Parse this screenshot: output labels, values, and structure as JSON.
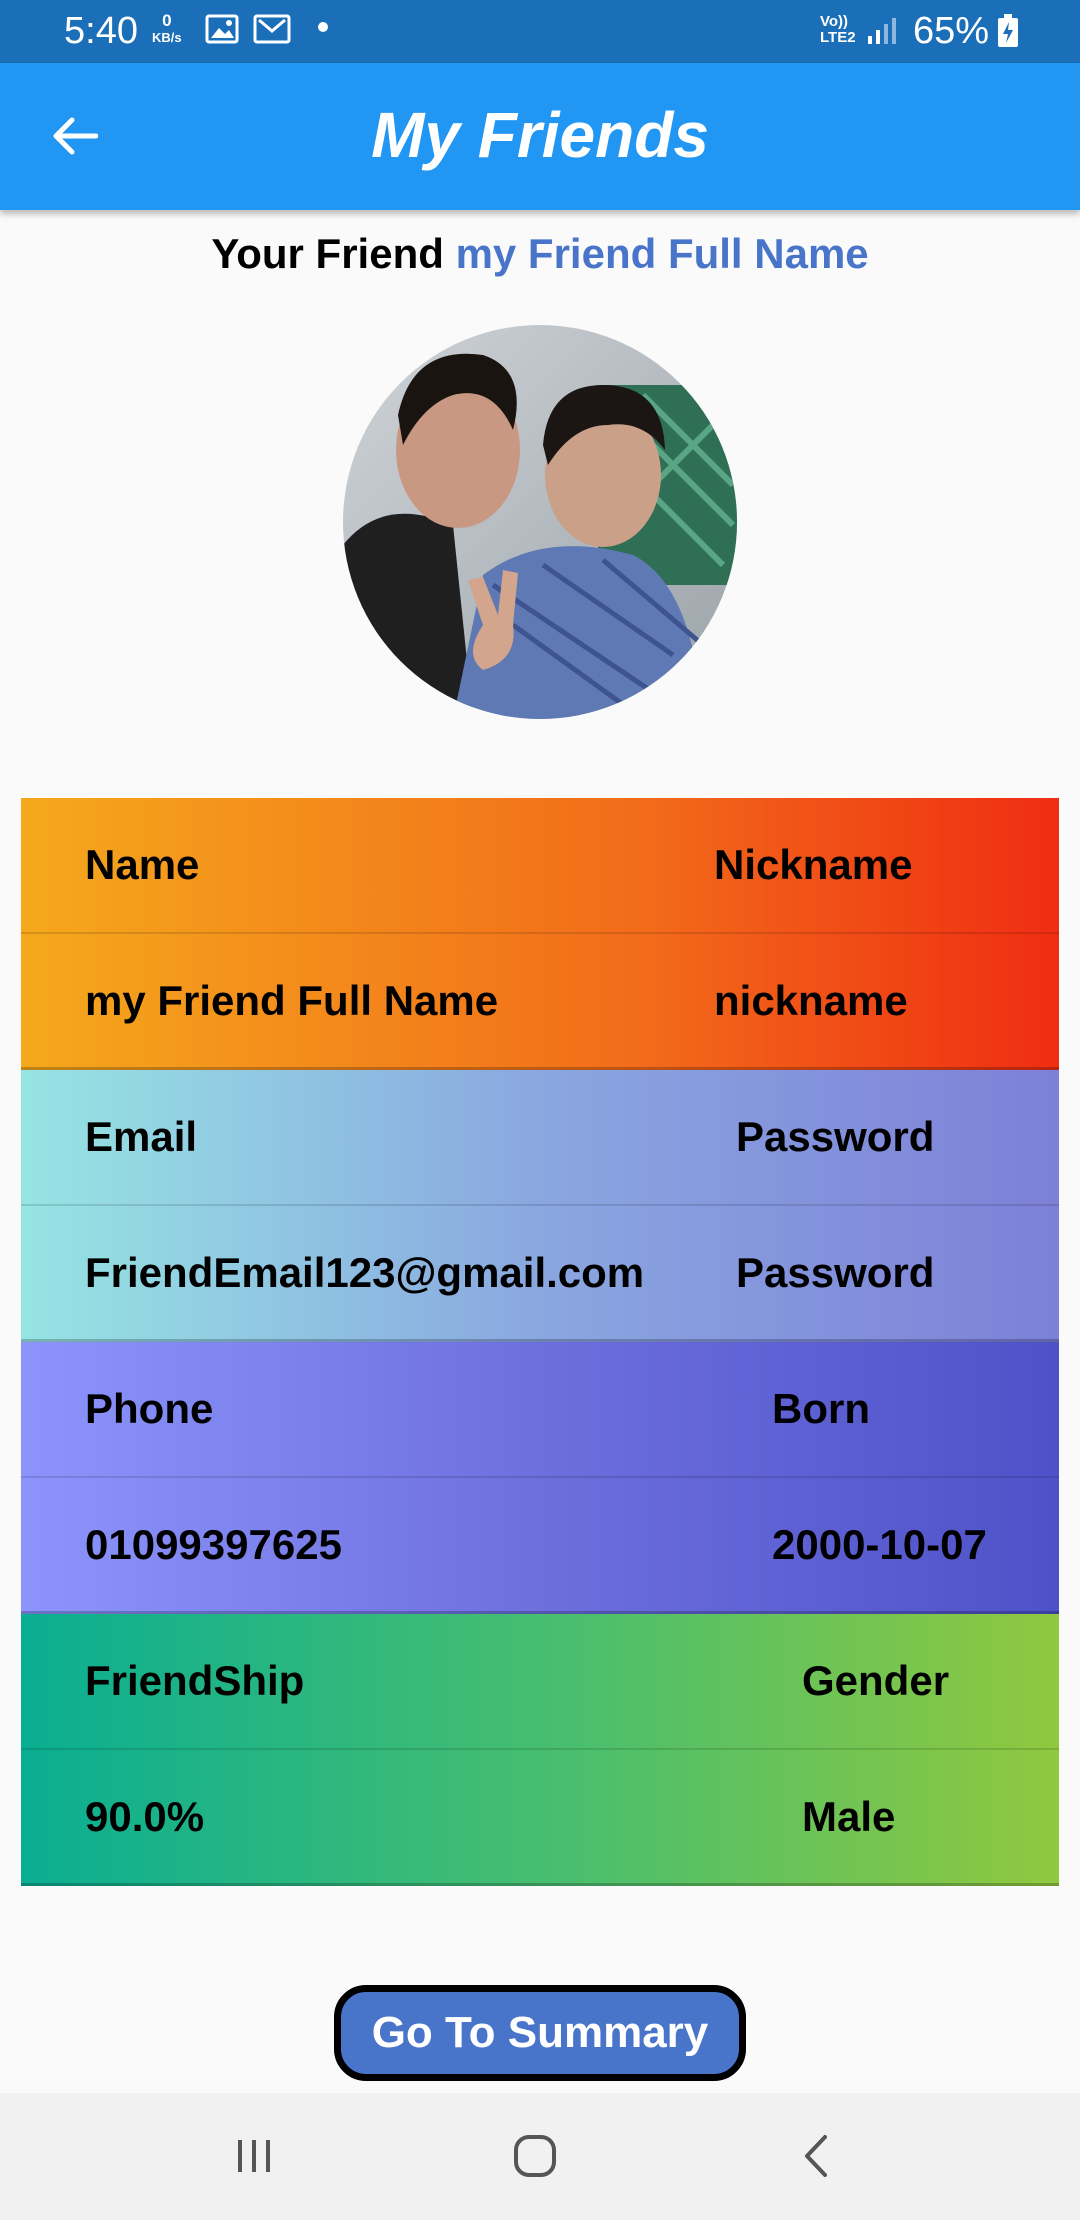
{
  "status_bar": {
    "time": "5:40",
    "net_speed_value": "0",
    "net_speed_unit": "KB/s",
    "signal_label_top": "Vo))",
    "signal_label_bottom": "LTE2",
    "battery": "65%"
  },
  "app_bar": {
    "title": "My Friends"
  },
  "heading": {
    "prefix": "Your Friend",
    "name": "my Friend Full Name"
  },
  "table": {
    "groups": [
      {
        "label_left": "Name",
        "label_right": "Nickname",
        "value_left": "my Friend Full Name",
        "value_right": "nickname"
      },
      {
        "label_left": "Email",
        "label_right": "Password",
        "value_left": "FriendEmail123@gmail.com",
        "value_right": "Password"
      },
      {
        "label_left": "Phone",
        "label_right": "Born",
        "value_left": "01099397625",
        "value_right": "2000-10-07"
      },
      {
        "label_left": "FriendShip",
        "label_right": "Gender",
        "value_left": "90.0%",
        "value_right": "Male"
      }
    ]
  },
  "summary_button": {
    "label": "Go To Summary"
  },
  "colors": {
    "status_bar": "#1a6fb8",
    "app_bar": "#2196f3",
    "accent_name": "#4874c9",
    "button_fill": "#4874c9"
  },
  "icons": {
    "back": "arrow-left-icon",
    "nav_recents": "recents-icon",
    "nav_home": "home-icon",
    "nav_back": "chevron-left-icon"
  }
}
